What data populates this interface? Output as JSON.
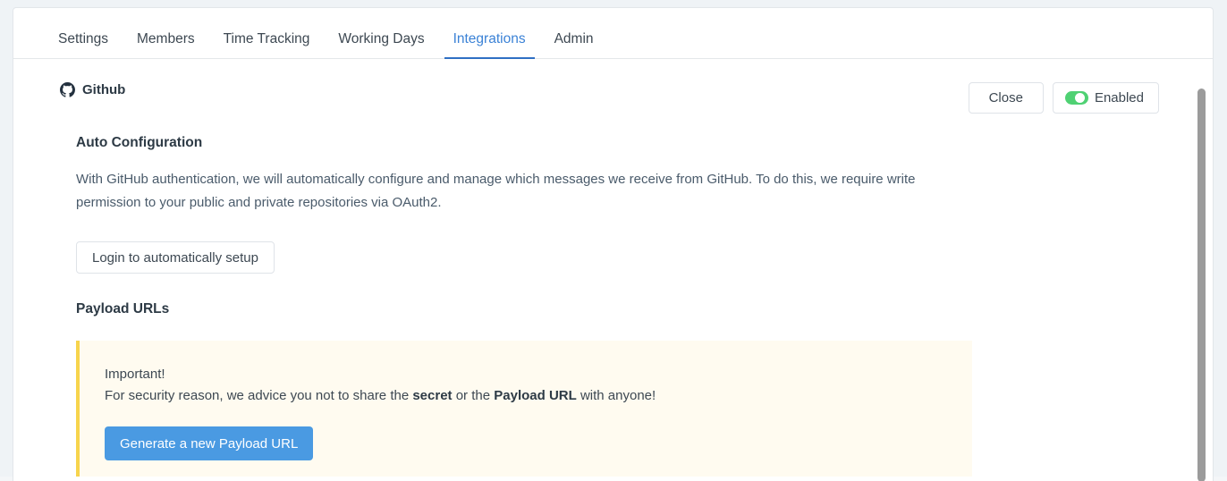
{
  "tabs": [
    {
      "label": "Settings",
      "active": false
    },
    {
      "label": "Members",
      "active": false
    },
    {
      "label": "Time Tracking",
      "active": false
    },
    {
      "label": "Working Days",
      "active": false
    },
    {
      "label": "Integrations",
      "active": true
    },
    {
      "label": "Admin",
      "active": false
    }
  ],
  "panel": {
    "title": "Github",
    "icon": "github-icon",
    "actions": {
      "close_label": "Close",
      "toggle_label": "Enabled",
      "toggle_state": "on",
      "toggle_color": "#4fd173"
    }
  },
  "auto_configuration": {
    "heading": "Auto Configuration",
    "description": "With GitHub authentication, we will automatically configure and manage which messages we receive from GitHub. To do this, we require write permission to your public and private repositories via OAuth2.",
    "login_button": "Login to automatically setup"
  },
  "payload_urls": {
    "heading": "Payload URLs",
    "alert": {
      "title": "Important!",
      "text_before_secret": "For security reason, we advice you not to share the ",
      "secret_word": "secret",
      "text_middle": " or the ",
      "payload_word": "Payload URL",
      "text_after": " with anyone!",
      "border_color": "#f7d44c",
      "background_color": "#fffbf0"
    },
    "generate_button": "Generate a new Payload URL",
    "generate_button_color": "#4a9ae2"
  },
  "theme": {
    "active_tab_color": "#3b82d6",
    "card_background": "#ffffff",
    "page_background": "#eff3f6"
  }
}
